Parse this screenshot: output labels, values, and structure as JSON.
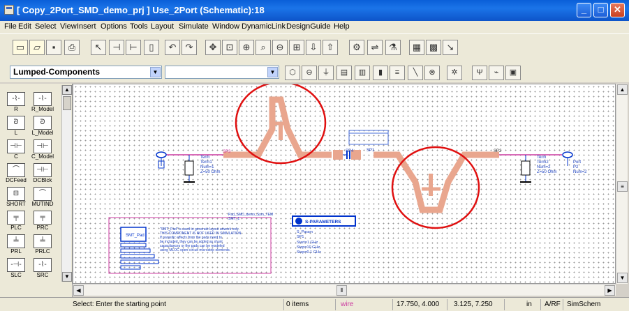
{
  "title": "[ Copy_2Port_SMD_demo_prj ] Use_2Port (Schematic):18",
  "menu": [
    "File",
    "Edit",
    "Select",
    "View",
    "Insert",
    "Options",
    "Tools",
    "Layout",
    "Simulate",
    "Window",
    "DynamicLink",
    "DesignGuide",
    "Help"
  ],
  "palette_combo": "Lumped-Components",
  "palette_items": [
    "R",
    "R_Model",
    "L",
    "L_Model",
    "C",
    "C_Model",
    "DCFeed",
    "DCBlck",
    "SHORT",
    "MUTIND",
    "PLC",
    "PRC",
    "PRL",
    "PRLC",
    "SLC",
    "SRC"
  ],
  "schematic": {
    "port_left": {
      "name": "Term",
      "ref": "Term1",
      "num": "Num=1",
      "z": "Z=50 Ohm"
    },
    "port_right": {
      "name": "Term",
      "ref": "Term2",
      "num": "Num=2",
      "z": "Z=50 Ohm"
    },
    "port_right2": {
      "name": "Port",
      "ref": "P2",
      "num": "Num=2"
    },
    "labels": {
      "p1": "SP1",
      "p2": "SP2",
      "p3": "SP3",
      "p4": "SP4",
      "smt_header": "Pad_SMD_demo_Sym_TEM",
      "smt_inst": "SMT_1"
    },
    "smt_block_label": "SMT_Pad",
    "note_lines": [
      "\"SMT_Pad\" is used to generate layout artwork only.",
      "THIS COMPONENT IS NOT USED IN SIMULATION.",
      "If parasitic effects from the pads need to",
      "be included, they can be added as shunt",
      "capacitances or the pads can be modeled",
      "using MLOC open-circuit microstrip elements."
    ],
    "sparams": {
      "title": "S-PARAMETERS",
      "ref": "S_Param",
      "name": "SP1",
      "start": "Start=1 GHz",
      "stop": "Stop=10 GHz",
      "step": "Step=0.1 GHz"
    }
  },
  "status": {
    "prompt": "Select: Enter the starting point",
    "items": "0 items",
    "mode": "wire",
    "coord1": "17.750, 4.000",
    "coord2": "3.125, 7.250",
    "unit": "in",
    "layer": "A/RF",
    "sim": "SimSchem"
  },
  "colors": {
    "trace": "#e9a68e",
    "wire": "#cc3aa0",
    "circle": "#e01010",
    "component": "#0033cc"
  }
}
